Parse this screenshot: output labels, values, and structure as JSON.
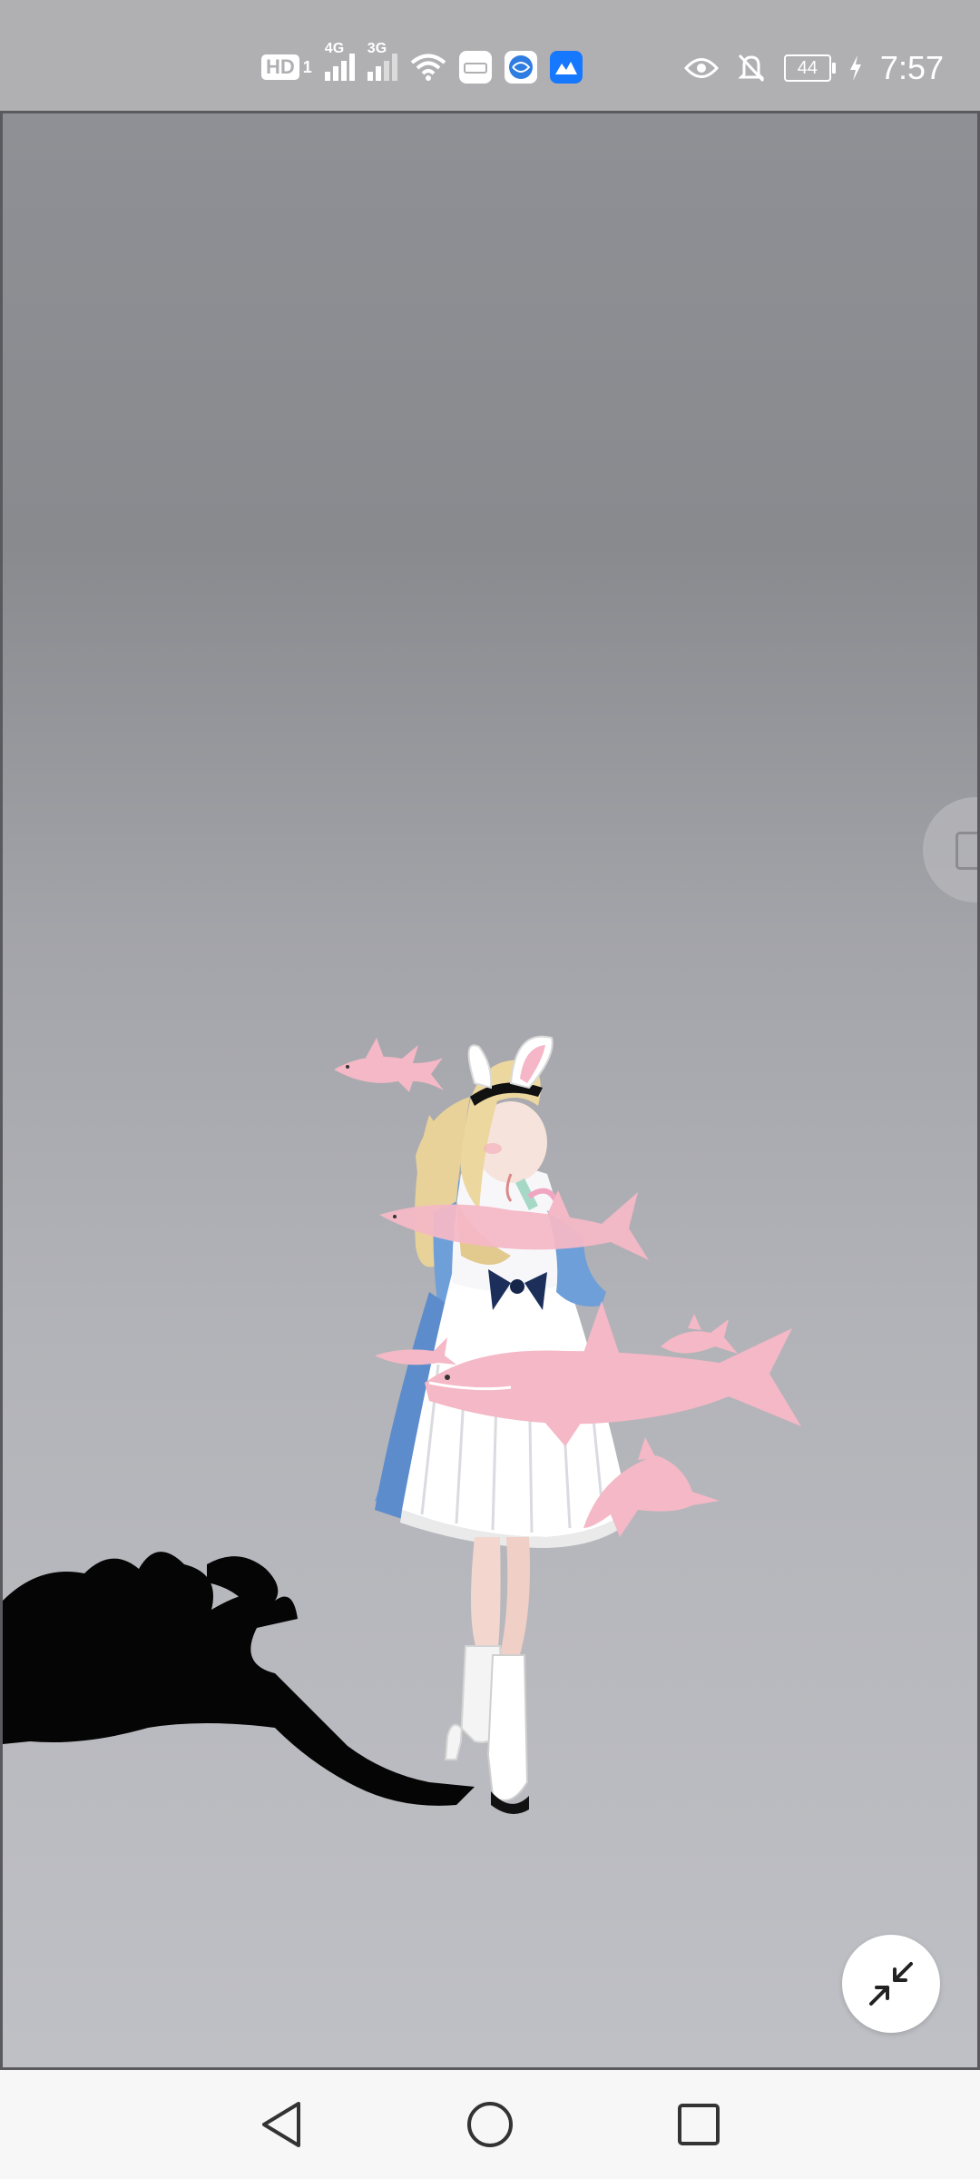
{
  "status_bar": {
    "hd_label": "HD",
    "sim_label": "1",
    "network_1": "4G",
    "network_2": "3G",
    "battery_level": "44",
    "time": "7:57",
    "icons": [
      "wifi-icon",
      "huawei-app-icon",
      "browser-app-icon",
      "cloud-app-icon",
      "eye-icon",
      "bell-muted-icon",
      "battery-icon",
      "charging-icon"
    ]
  },
  "viewer": {
    "scene": "3d-avatar-view",
    "avatar_outfit_colors": {
      "dress": "#ffffff",
      "sleeves": "#6f9fd8",
      "hair": "#e8d29a",
      "sharks": "#f4b8c6"
    },
    "minimize_icon": "minimize-arrows-icon",
    "side_handle_icon": "window-icon"
  },
  "nav_bar": {
    "back_icon": "back-triangle-icon",
    "home_icon": "home-circle-icon",
    "recents_icon": "recents-square-icon"
  }
}
